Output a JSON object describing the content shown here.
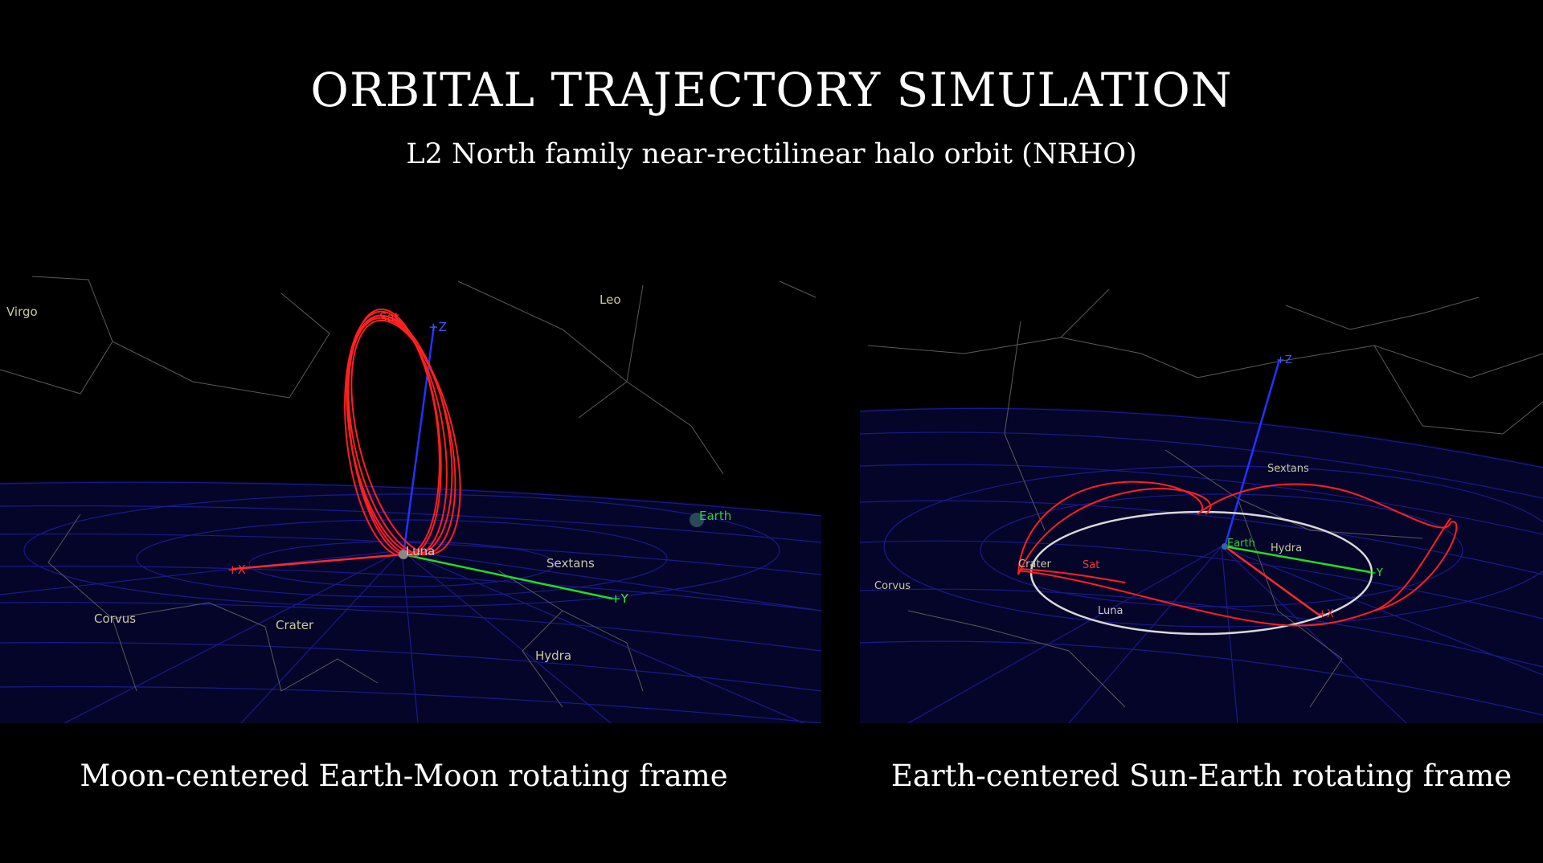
{
  "header": {
    "title": "ORBITAL TRAJECTORY SIMULATION",
    "subtitle": "L2 North family near-rectilinear halo orbit (NRHO)"
  },
  "panels": [
    {
      "caption": "Moon-centered Earth-Moon rotating frame",
      "constellations": {
        "virgo": "Virgo",
        "leo": "Leo",
        "sextans": "Sextans",
        "corvus": "Corvus",
        "crater": "Crater",
        "hydra": "Hydra"
      },
      "bodies": {
        "earth": "Earth",
        "luna": "Luna",
        "sat": "Sat"
      },
      "axes": {
        "x": "+X",
        "y": "+Y",
        "z": "+Z"
      }
    },
    {
      "caption": "Earth-centered Sun-Earth rotating frame",
      "constellations": {
        "sextans": "Sextans",
        "hydra": "Hydra",
        "corvus": "Corvus",
        "crater": "Crater"
      },
      "bodies": {
        "earth": "Earth",
        "luna": "Luna",
        "sat": "Sat"
      },
      "axes": {
        "x": "+X",
        "y": "+Y",
        "z": "+Z"
      }
    }
  ],
  "colors": {
    "orbit": "#ff2020",
    "x_axis": "#ff2a2a",
    "y_axis": "#22dd22",
    "z_axis": "#2233ff",
    "grid": "#1a1a8a",
    "moon_orbit": "#d8d8d8",
    "constellation_label": "#c8c8a0",
    "constellation_line": "#5a5a5a"
  }
}
